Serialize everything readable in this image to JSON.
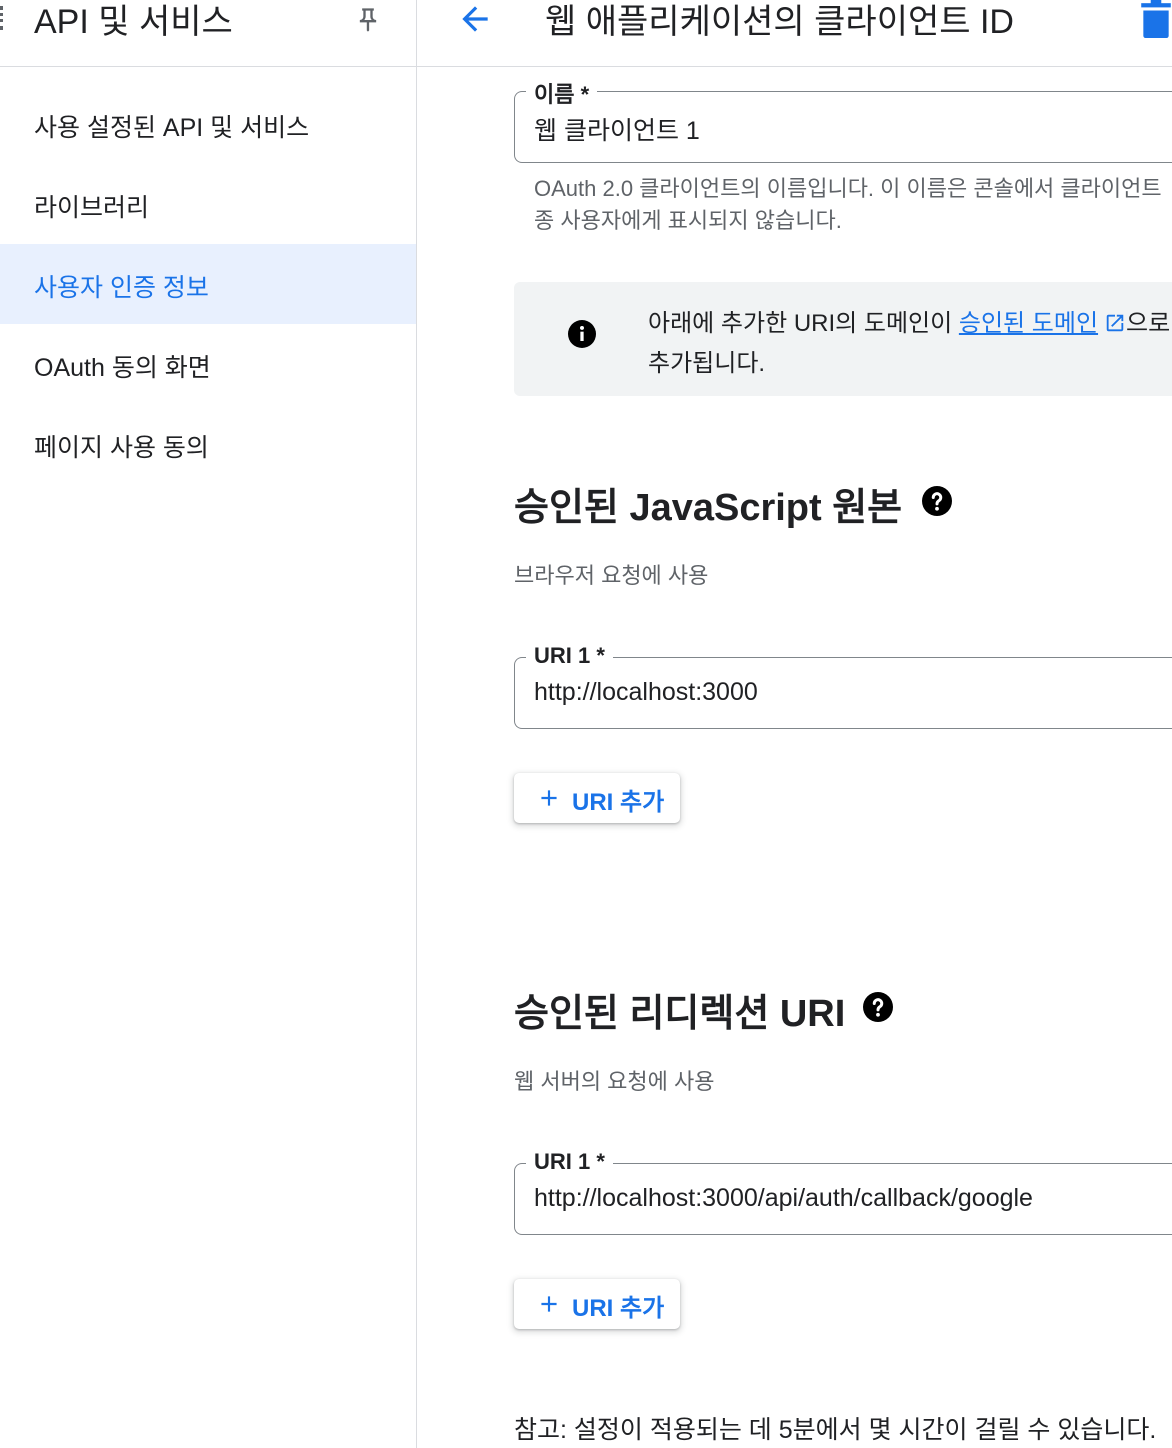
{
  "sidebar": {
    "title": "API 및 서비스",
    "items": [
      {
        "label": "사용 설정된 API 및 서비스"
      },
      {
        "label": "라이브러리"
      },
      {
        "label": "사용자 인증 정보"
      },
      {
        "label": "OAuth 동의 화면"
      },
      {
        "label": "페이지 사용 동의"
      }
    ]
  },
  "header": {
    "title": "웹 애플리케이션의 클라이언트 ID"
  },
  "name_field": {
    "label": "이름 *",
    "value": "웹 클라이언트 1",
    "helper_line1": "OAuth 2.0 클라이언트의 이름입니다. 이 이름은 콘솔에서 클라이언트",
    "helper_line2": "종 사용자에게 표시되지 않습니다."
  },
  "info": {
    "text_before": "아래에 추가한 URI의 도메인이 ",
    "link": "승인된 도메인",
    "text_after": "으로",
    "line2": "추가됩니다."
  },
  "js_origins": {
    "title": "승인된 JavaScript 원본",
    "description": "브라우저 요청에 사용",
    "uri_label": "URI 1 *",
    "uri_value": "http://localhost:3000",
    "add_label": "URI 추가"
  },
  "redirect_uris": {
    "title": "승인된 리디렉션 URI",
    "description": "웹 서버의 요청에 사용",
    "uri_label": "URI 1 *",
    "uri_value": "http://localhost:3000/api/auth/callback/google",
    "add_label": "URI 추가"
  },
  "note": "참고: 설정이 적용되는 데 5분에서 몇 시간이 걸릴 수 있습니다.",
  "colors": {
    "accent": "#1a73e8",
    "active_bg": "#e8f0fe",
    "info_bg": "#f1f3f4"
  }
}
